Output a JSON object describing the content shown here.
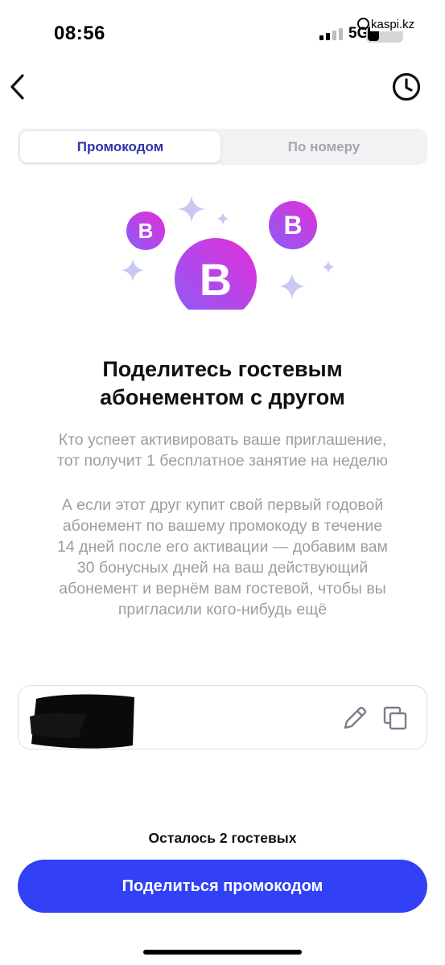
{
  "status_bar": {
    "time": "08:56",
    "network": "5G",
    "watermark": "kaspi.kz"
  },
  "nav": {
    "back_icon": "chevron-left-icon",
    "history_icon": "clock-icon"
  },
  "tabs": [
    {
      "label": "Промокодом",
      "active": true
    },
    {
      "label": "По номеру",
      "active": false
    }
  ],
  "hero": {
    "badge_letter": "B",
    "colors": {
      "gradient_start": "#8b5cf6",
      "gradient_end": "#e32fd9",
      "sparkle": "#c7c9f3"
    }
  },
  "content": {
    "title": "Поделитесь гостевым\nабонементом с другом",
    "paragraph_1": "Кто успеет активировать ваше приглашение,\nтот получит 1 бесплатное занятие на неделю",
    "paragraph_2": "А если этот друг купит свой первый годовой\nабонемент по вашему промокоду в течение\n14 дней после его активации — добавим вам\n30 бонусных дней на ваш действующий\nабонемент и вернём вам гостевой, чтобы вы\nпригласили кого-нибудь ещё"
  },
  "promo": {
    "edit_icon": "pencil-icon",
    "copy_icon": "copy-icon"
  },
  "footer": {
    "remaining": "Осталось 2 гостевых",
    "share_button": "Поделиться промокодом",
    "accent_color": "#3241f5"
  }
}
